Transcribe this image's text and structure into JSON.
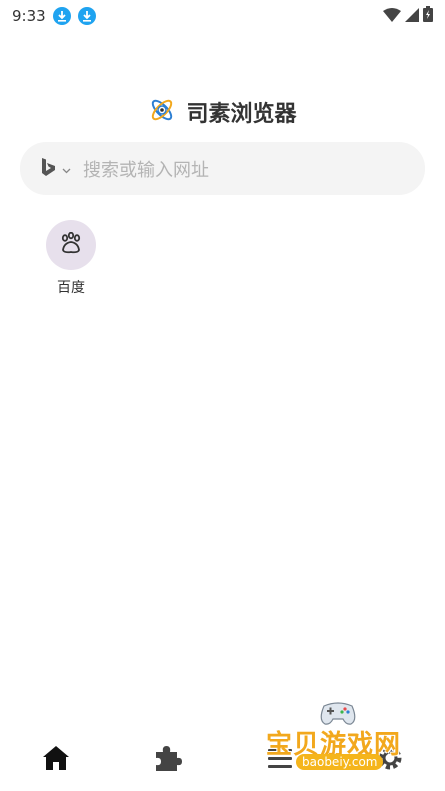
{
  "status_bar": {
    "time": "9:33",
    "icons": [
      "download-icon",
      "download-icon",
      "wifi-icon",
      "signal-icon",
      "battery-icon"
    ]
  },
  "app": {
    "name": "司素浏览器",
    "logo_icon": "atom-logo-icon"
  },
  "search": {
    "engine_icon": "bing-icon",
    "placeholder": "搜索或输入网址"
  },
  "shortcuts": [
    {
      "label": "百度",
      "icon": "baidu-paw-icon"
    }
  ],
  "bottom_nav": {
    "items": [
      "home-icon",
      "extensions-icon",
      "menu-icon",
      "settings-icon"
    ]
  },
  "watermark": {
    "text": "宝贝游戏网",
    "url": "baobeiy.com"
  },
  "colors": {
    "accent": "#1fa3f0",
    "shortcut_bg": "#e7e0ec",
    "search_bg": "#f4f4f4",
    "watermark": "#f2a81d"
  }
}
